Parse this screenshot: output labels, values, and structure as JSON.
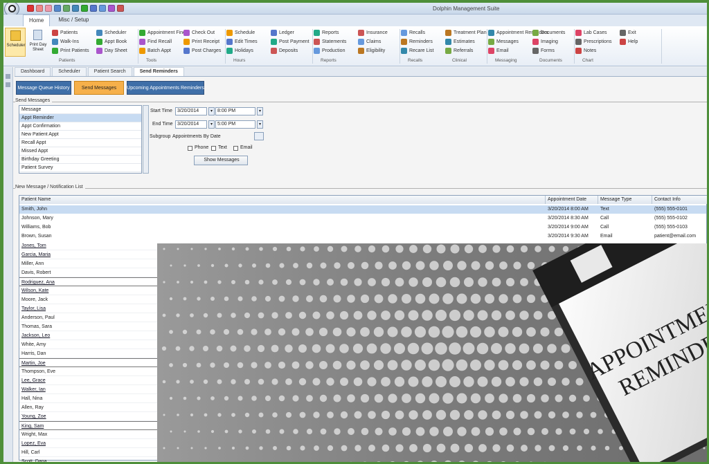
{
  "window": {
    "title": "Dolphin Management Suite"
  },
  "ribbon": {
    "tabs": [
      "Home",
      "Misc / Setup"
    ],
    "big_buttons": [
      {
        "label": "Scheduler"
      },
      {
        "label": "Print Day Sheet"
      }
    ],
    "groups": [
      {
        "items": [
          "Patients",
          "Walk-Ins",
          "Print Patients"
        ],
        "footer": "Patients"
      },
      {
        "items": [
          "Scheduler",
          "Appt Book",
          "Day Sheet"
        ],
        "footer": ""
      },
      {
        "items": [
          "Appointment Finder",
          "Find Recall",
          "Batch Appt"
        ],
        "footer": "Tools"
      },
      {
        "items": [
          "Check Out",
          "Print Receipt",
          "Post Charges"
        ],
        "footer": ""
      },
      {
        "items": [
          "Schedule",
          "Edit Times",
          "Holidays"
        ],
        "footer": "Hours"
      },
      {
        "items": [
          "Ledger",
          "Post Payment",
          "Deposits"
        ],
        "footer": ""
      },
      {
        "items": [
          "Reports",
          "Statements",
          "Production"
        ],
        "footer": "Reports"
      },
      {
        "items": [
          "Insurance",
          "Claims",
          "Eligibility"
        ],
        "footer": ""
      },
      {
        "items": [
          "Recalls",
          "Reminders",
          "Recare List"
        ],
        "footer": "Recalls"
      },
      {
        "items": [
          "Treatment Plan",
          "Estimates",
          "Referrals"
        ],
        "footer": "Clinical"
      },
      {
        "items": [
          "Appointment Reminders",
          "Messages",
          "Email"
        ],
        "footer": "Messaging"
      },
      {
        "items": [
          "Documents",
          "Imaging",
          "Forms"
        ],
        "footer": "Documents"
      },
      {
        "items": [
          "Lab Cases",
          "Prescriptions",
          "Notes"
        ],
        "footer": "Chart"
      },
      {
        "items": [
          "Exit",
          "Help"
        ],
        "footer": ""
      }
    ]
  },
  "doc_tabs": [
    "Dashboard",
    "Scheduler",
    "Patient Search",
    "Send Reminders"
  ],
  "toolbar": {
    "btn1": "Message Queue History",
    "btn2": "Send Messages",
    "btn3": "Upcoming Appointments Reminders"
  },
  "section_send": {
    "label": "Send Messages"
  },
  "message_types": [
    "Message",
    "Appt Reminder",
    "Appt Confirmation",
    "New Patient Appt",
    "Recall Appt",
    "Missed Appt",
    "Birthday Greeting",
    "Patient Survey"
  ],
  "form": {
    "start_label": "Start Time",
    "start_date": "3/20/2014",
    "start_time": "8:00 PM",
    "end_label": "End Time",
    "end_date": "3/20/2014",
    "end_time": "5:00 PM",
    "subgroup_label": "Subgroup",
    "subgroup_value": "Appointments By Date",
    "checks": [
      "Phone",
      "Text",
      "Email"
    ],
    "go_label": "Show Messages"
  },
  "section_grid": {
    "label": "New Message / Notification List"
  },
  "grid": {
    "headers": [
      "Patient Name",
      "Appointment Date",
      "Message Type",
      "Contact Info"
    ],
    "rows": [
      {
        "name": "Smith, John",
        "date": "3/20/2014 8:00 AM",
        "type": "Text",
        "contact": "(555) 555-0101"
      },
      {
        "name": "Johnson, Mary",
        "date": "3/20/2014 8:30 AM",
        "type": "Call",
        "contact": "(555) 555-0102"
      },
      {
        "name": "Williams, Bob",
        "date": "3/20/2014 9:00 AM",
        "type": "Call",
        "contact": "(555) 555-0103"
      },
      {
        "name": "Brown, Susan",
        "date": "3/20/2014 9:30 AM",
        "type": "Email",
        "contact": "patient@email.com"
      }
    ],
    "names": [
      "Jones, Tom",
      "Garcia, Maria",
      "Miller, Ann",
      "Davis, Robert",
      "Rodriguez, Ana",
      "Wilson, Kate",
      "Moore, Jack",
      "Taylor, Lisa",
      "Anderson, Paul",
      "Thomas, Sara",
      "Jackson, Leo",
      "White, Amy",
      "Harris, Dan",
      "Martin, Joe",
      "Thompson, Eve",
      "Lee, Grace",
      "Walker, Ian",
      "Hall, Nina",
      "Allen, Ray",
      "Young, Zoe",
      "King, Sam",
      "Wright, Max",
      "Lopez, Eva",
      "Hill, Carl",
      "Scott, Dana"
    ]
  },
  "promo": {
    "line1": "APPOINTMENT",
    "line2": "REMINDER"
  }
}
